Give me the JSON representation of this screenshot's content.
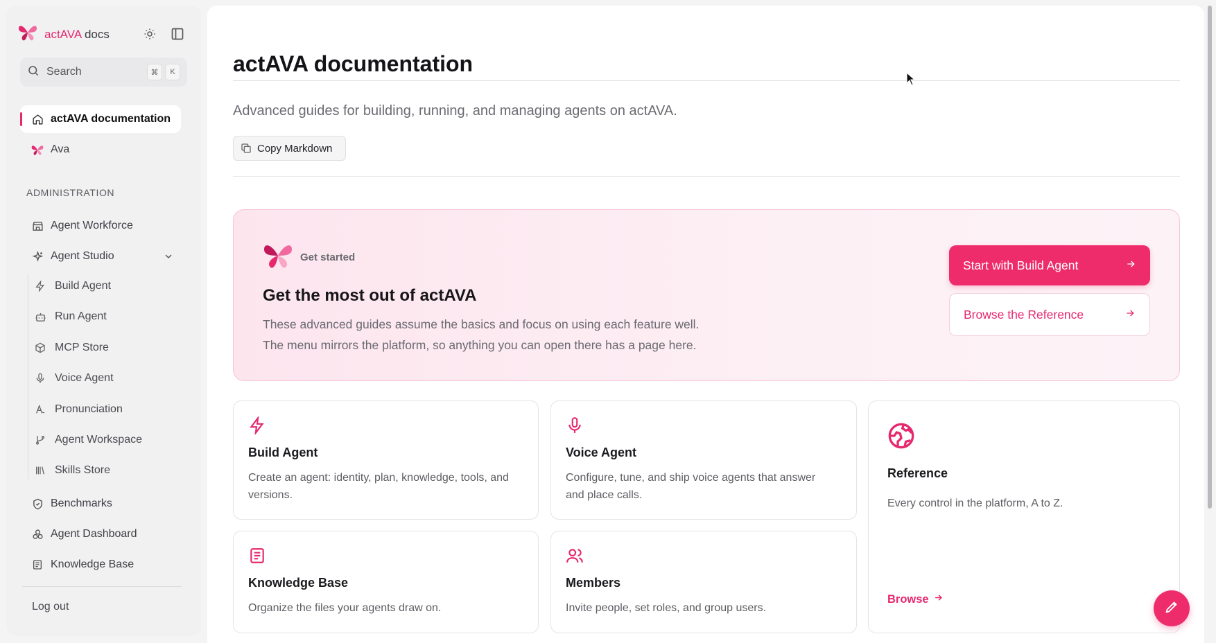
{
  "sidebar": {
    "brand": {
      "name_accent": "actAVA",
      "name_rest": " docs"
    },
    "search": {
      "placeholder": "Search",
      "shortcut": [
        "⌘",
        "K"
      ]
    },
    "top_items": [
      {
        "label": "actAVA documentation",
        "icon": "home-icon",
        "active": true
      },
      {
        "label": "Ava",
        "icon": "butterfly-icon"
      }
    ],
    "section_title": "ADMINISTRATION",
    "items": [
      {
        "label": "Agent Workforce",
        "icon": "store-icon"
      },
      {
        "label": "Agent Studio",
        "icon": "sparkles-icon",
        "expanded": true
      },
      {
        "label": "Build Agent",
        "icon": "zap-icon"
      },
      {
        "label": "Run Agent",
        "icon": "bot-icon"
      },
      {
        "label": "MCP Store",
        "icon": "package-icon"
      },
      {
        "label": "Voice Agent",
        "icon": "mic-icon"
      },
      {
        "label": "Pronunciation",
        "icon": "pronunciation-icon"
      },
      {
        "label": "Agent Workspace",
        "icon": "git-branch-icon"
      },
      {
        "label": "Skills Store",
        "icon": "library-icon"
      },
      {
        "label": "Benchmarks",
        "icon": "shield-check-icon"
      },
      {
        "label": "Agent Dashboard",
        "icon": "boxes-icon"
      },
      {
        "label": "Knowledge Base",
        "icon": "notebook-icon"
      }
    ],
    "logout": "Log out"
  },
  "main": {
    "title": "actAVA documentation",
    "subtitle": "Advanced guides for building, running, and managing agents on actAVA.",
    "copy_button": "Copy Markdown",
    "hero": {
      "eyebrow": "Get started",
      "title": "Get the most out of actAVA",
      "desc_line1": "These advanced guides assume the basics and focus on using each feature well.",
      "desc_line2": "The menu mirrors the platform, so anything you can open there has a page here.",
      "primary_button": "Start with Build Agent",
      "secondary_button": "Browse the Reference"
    },
    "cards": [
      {
        "title": "Build Agent",
        "desc": "Create an agent: identity, plan, knowledge, tools, and versions.",
        "icon": "zap-icon"
      },
      {
        "title": "Voice Agent",
        "desc": "Configure, tune, and ship voice agents that answer and place calls.",
        "icon": "mic-icon"
      },
      {
        "title": "Knowledge Base",
        "desc": "Organize the files your agents draw on.",
        "icon": "notebook-icon"
      },
      {
        "title": "Members",
        "desc": "Invite people, set roles, and group users.",
        "icon": "users-icon"
      }
    ],
    "reference_card": {
      "title": "Reference",
      "desc": "Every control in the platform, A to Z.",
      "link": "Browse",
      "icon": "globe-icon"
    }
  },
  "colors": {
    "accent": "#e6296f",
    "primary_button": "#ee2c6c"
  }
}
